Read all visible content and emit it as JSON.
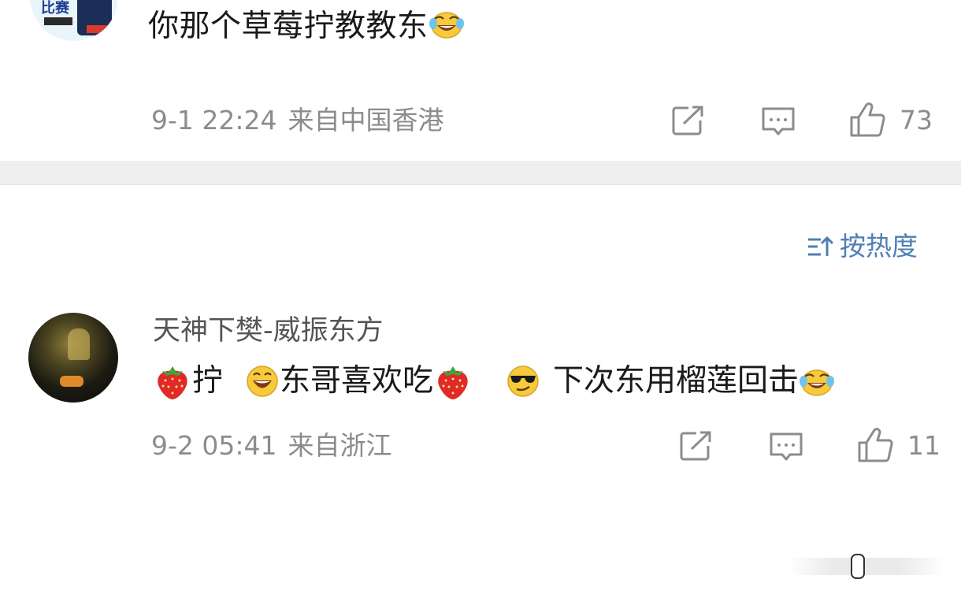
{
  "comment1": {
    "avatar_icon": "avatar-sports-fan",
    "avatar_text": "比赛",
    "text": "你那个草莓拧教教东",
    "trailing_emoji": "tears-of-joy-emoji",
    "time": "9-1 22:24",
    "location": "来自中国香港",
    "like_count": "73"
  },
  "sort": {
    "label": "按热度",
    "icon": "sort-icon"
  },
  "comment2": {
    "avatar_icon": "avatar-dark-photo",
    "username": "天神下樊-威振东方",
    "segments": {
      "s1": "拧",
      "s2": "东哥喜欢吃",
      "s3": "下次东用榴莲回击"
    },
    "emojis": [
      "strawberry-emoji",
      "grinning-emoji",
      "strawberry-emoji",
      "sunglasses-emoji",
      "tears-of-joy-emoji"
    ],
    "time": "9-2 05:41",
    "location": "来自浙江",
    "like_count": "11"
  },
  "colors": {
    "meta_gray": "#8c8c8c",
    "link_blue": "#4f7fb3",
    "divider": "#eeeeee"
  }
}
